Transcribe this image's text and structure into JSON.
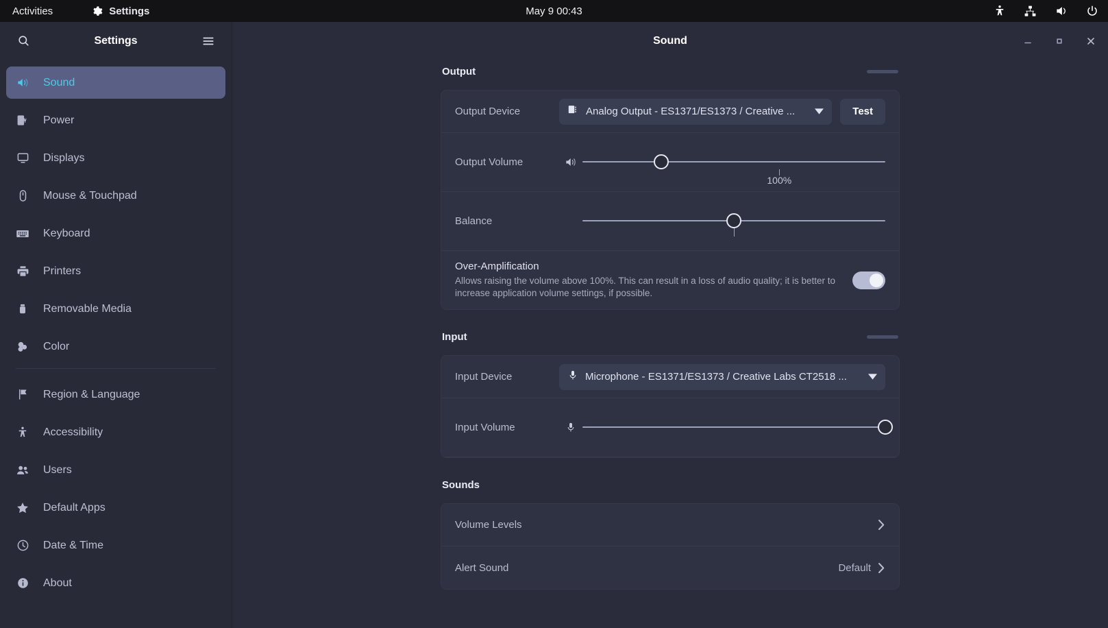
{
  "topbar": {
    "activities": "Activities",
    "app_name": "Settings",
    "clock": "May 9  00:43",
    "icons": [
      "accessibility-icon",
      "network-wired-icon",
      "volume-icon",
      "power-icon"
    ]
  },
  "sidebar": {
    "title": "Settings",
    "search_icon": "search-icon",
    "menu_icon": "hamburger-menu-icon",
    "items": [
      {
        "label": "Sound",
        "icon": "speaker-icon",
        "selected": true
      },
      {
        "label": "Power",
        "icon": "power-plug-icon",
        "selected": false
      },
      {
        "label": "Displays",
        "icon": "display-icon",
        "selected": false
      },
      {
        "label": "Mouse & Touchpad",
        "icon": "mouse-icon",
        "selected": false
      },
      {
        "label": "Keyboard",
        "icon": "keyboard-icon",
        "selected": false
      },
      {
        "label": "Printers",
        "icon": "printer-icon",
        "selected": false
      },
      {
        "label": "Removable Media",
        "icon": "usb-drive-icon",
        "selected": false
      },
      {
        "label": "Color",
        "icon": "color-icon",
        "selected": false
      },
      {
        "label": "Region & Language",
        "icon": "flag-icon",
        "selected": false,
        "separator_before": true
      },
      {
        "label": "Accessibility",
        "icon": "accessibility-icon",
        "selected": false
      },
      {
        "label": "Users",
        "icon": "users-icon",
        "selected": false
      },
      {
        "label": "Default Apps",
        "icon": "star-icon",
        "selected": false
      },
      {
        "label": "Date & Time",
        "icon": "clock-icon",
        "selected": false
      },
      {
        "label": "About",
        "icon": "info-icon",
        "selected": false
      }
    ]
  },
  "window": {
    "title": "Sound",
    "minimize": "minimize-button",
    "maximize": "maximize-button",
    "close": "close-button"
  },
  "output": {
    "heading": "Output",
    "device_label": "Output Device",
    "device_value": "Analog Output - ES1371/ES1373 / Creative ...",
    "device_icon": "audio-card-icon",
    "test_label": "Test",
    "volume_label": "Output Volume",
    "volume_icon": "volume-high-icon",
    "volume_percent": 26,
    "volume_tick_label": "100%",
    "volume_tick_percent": 65,
    "balance_label": "Balance",
    "balance_percent": 50,
    "over_amp_title": "Over-Amplification",
    "over_amp_desc": "Allows raising the volume above 100%. This can result in a loss of audio quality; it is better to increase application volume settings, if possible.",
    "over_amp_enabled": true
  },
  "input": {
    "heading": "Input",
    "device_label": "Input Device",
    "device_value": "Microphone - ES1371/ES1373 / Creative Labs CT2518 ...",
    "device_icon": "microphone-icon",
    "volume_label": "Input Volume",
    "volume_icon": "microphone-icon",
    "volume_percent": 100
  },
  "sounds": {
    "heading": "Sounds",
    "rows": [
      {
        "label": "Volume Levels",
        "value": ""
      },
      {
        "label": "Alert Sound",
        "value": "Default"
      }
    ]
  },
  "colors": {
    "accent_selected_bg": "#5a6085",
    "accent_selected_text": "#4ec9e8",
    "window_bg": "#2a2c3c",
    "sidebar_bg": "#282a38",
    "card_bg": "#2f3243",
    "topbar_bg": "#131316",
    "switch_on": "#b7bbd4"
  }
}
